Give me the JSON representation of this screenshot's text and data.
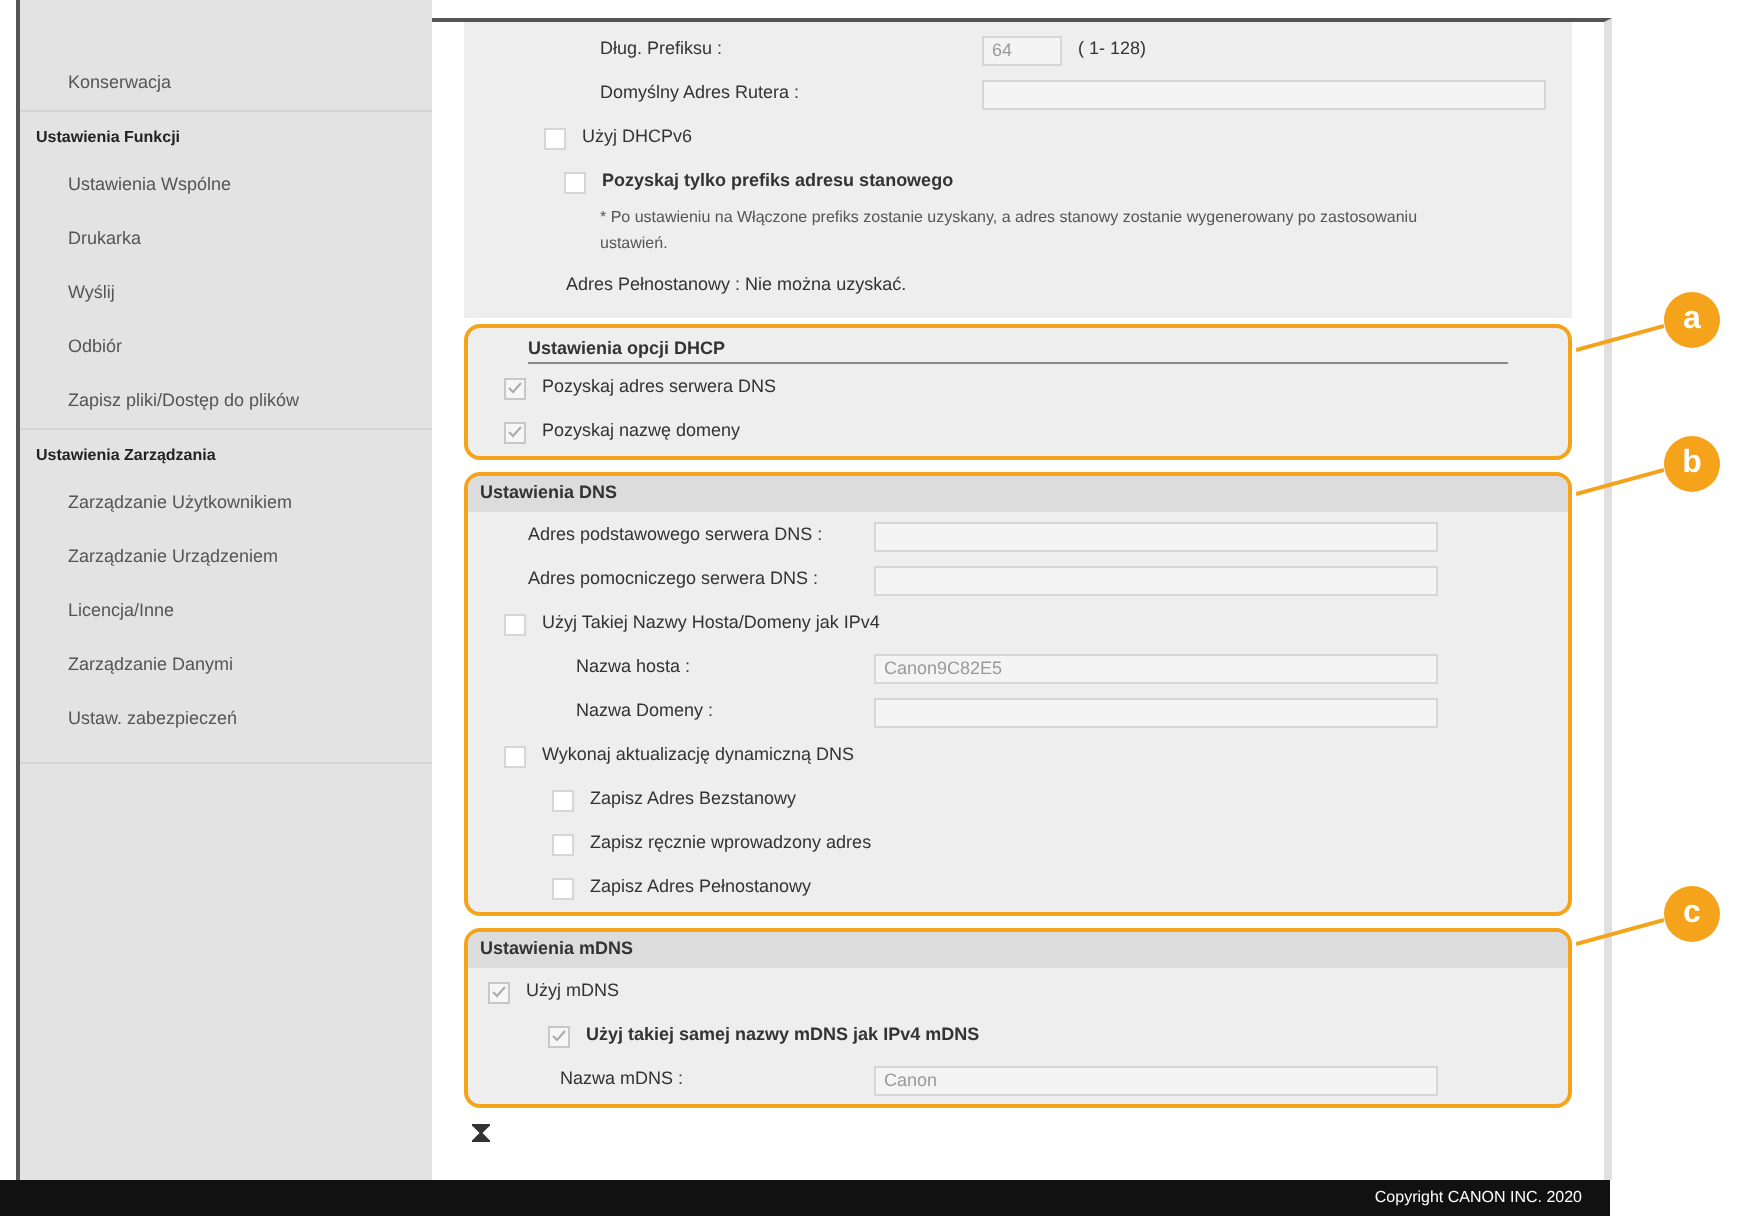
{
  "sidebar": {
    "items": [
      {
        "kind": "item",
        "label": "Konserwacja"
      },
      {
        "kind": "header",
        "label": "Ustawienia Funkcji"
      },
      {
        "kind": "item",
        "label": "Ustawienia Wspólne"
      },
      {
        "kind": "item",
        "label": "Drukarka"
      },
      {
        "kind": "item",
        "label": "Wyślij"
      },
      {
        "kind": "item",
        "label": "Odbiór"
      },
      {
        "kind": "item",
        "label": "Zapisz pliki/Dostęp do plików"
      },
      {
        "kind": "header",
        "label": "Ustawienia Zarządzania"
      },
      {
        "kind": "item",
        "label": "Zarządzanie Użytkownikiem"
      },
      {
        "kind": "item",
        "label": "Zarządzanie Urządzeniem"
      },
      {
        "kind": "item",
        "label": "Licencja/Inne"
      },
      {
        "kind": "item",
        "label": "Zarządzanie Danymi"
      },
      {
        "kind": "item",
        "label": "Ustaw. zabezpieczeń"
      }
    ]
  },
  "ipv6_panel": {
    "rows": [
      {
        "kind": "field",
        "label": "Dług. Prefiksu :",
        "value": "64",
        "hint": "( 1- 128)"
      },
      {
        "kind": "field",
        "label": "Domyślny Adres Rutera :"
      },
      {
        "kind": "checkbox",
        "label": "Użyj DHCPv6",
        "checked": false,
        "children": [
          {
            "kind": "emphasized",
            "label": "Pozyskaj tylko prefiks adresu stanowego",
            "checked": false,
            "children": [
              {
                "kind": "note",
                "label": "* Po ustawieniu na Włączone prefiks zostanie uzyskany, a adres stanowy zostanie wygenerowany po zastosowaniu ustawień."
              }
            ]
          }
        ]
      },
      {
        "kind": "text",
        "label": "Adres Pełnostanowy : Nie można uzyskać."
      }
    ]
  },
  "sections": [
    {
      "callout": "a",
      "title": "Ustawienia opcji DHCP",
      "rows": [
        {
          "kind": "checkbox",
          "label": "Pozyskaj adres serwera DNS",
          "checked": true
        },
        {
          "kind": "checkbox",
          "label": "Pozyskaj nazwę domeny",
          "checked": true
        }
      ]
    },
    {
      "callout": "b",
      "title": "Ustawienia DNS",
      "rows": [
        {
          "kind": "field",
          "label": "Adres podstawowego serwera DNS :"
        },
        {
          "kind": "field",
          "label": "Adres pomocniczego serwera DNS :"
        },
        {
          "kind": "checkbox",
          "label": "Użyj Takiej Nazwy Hosta/Domeny jak IPv4",
          "checked": false,
          "children": [
            {
              "kind": "field",
              "label": "Nazwa hosta :",
              "value": "Canon9C82E5"
            },
            {
              "kind": "field",
              "label": "Nazwa Domeny :"
            }
          ]
        },
        {
          "kind": "checkbox",
          "label": "Wykonaj aktualizację dynamiczną DNS",
          "checked": false,
          "children": [
            {
              "kind": "checkbox",
              "label": "Zapisz Adres Bezstanowy",
              "checked": false
            },
            {
              "kind": "checkbox",
              "label": "Zapisz ręcznie wprowadzony adres",
              "checked": false
            },
            {
              "kind": "checkbox",
              "label": "Zapisz Adres Pełnostanowy",
              "checked": false
            }
          ]
        }
      ]
    },
    {
      "callout": "c",
      "title": "Ustawienia mDNS",
      "rows": [
        {
          "kind": "checkbox",
          "label": "Użyj mDNS",
          "checked": true,
          "children": [
            {
              "kind": "emphasized",
              "label": "Użyj takiej samej nazwy mDNS jak IPv4 mDNS",
              "checked": true
            },
            {
              "kind": "field",
              "label": "Nazwa mDNS :",
              "value": "Canon"
            }
          ]
        }
      ]
    }
  ],
  "footer": {
    "copyright": "Copyright CANON INC. 2020"
  }
}
